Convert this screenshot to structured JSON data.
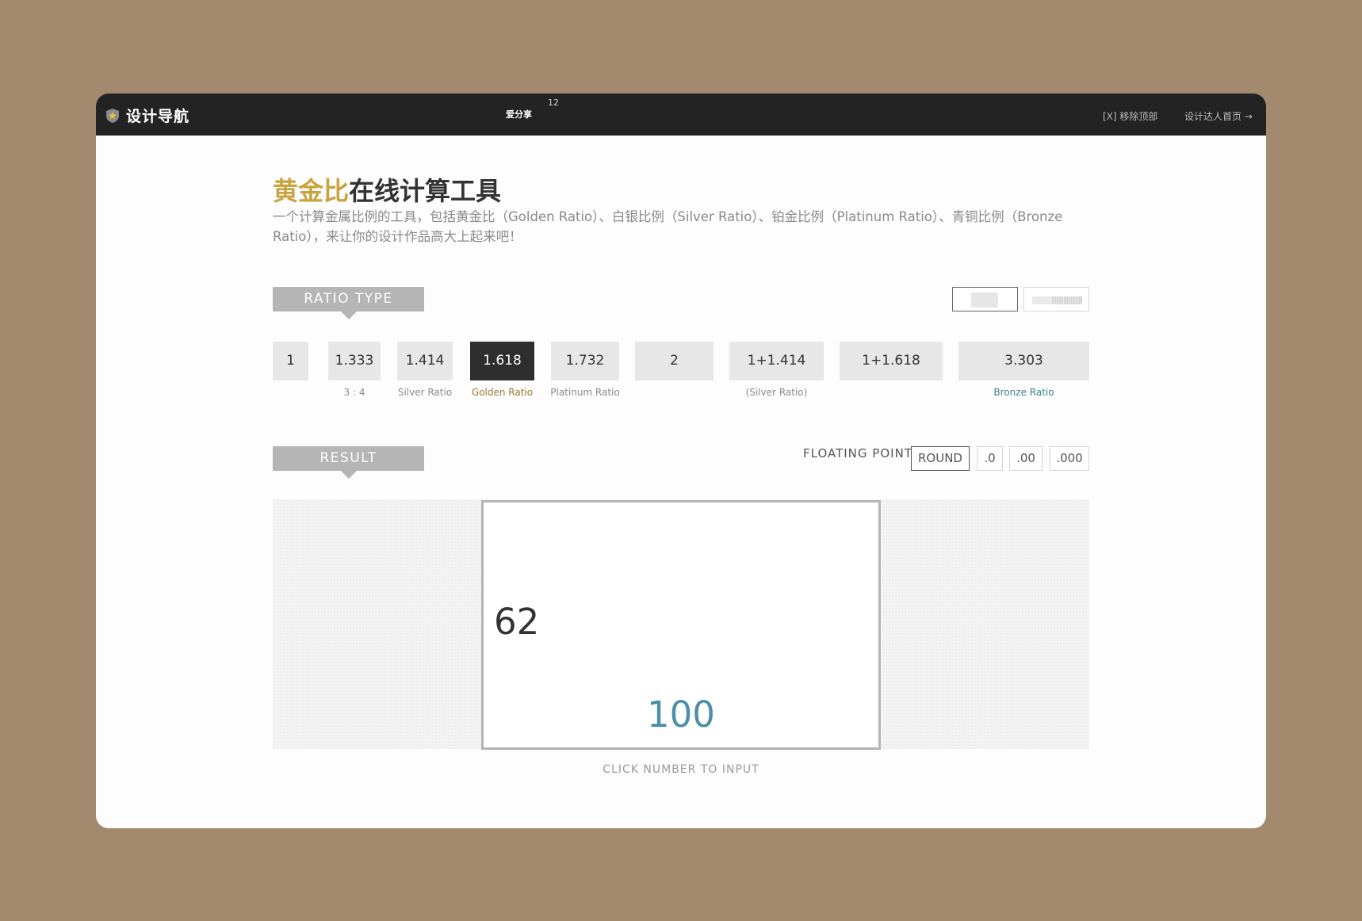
{
  "topbar": {
    "brand": "设计导航",
    "share_label": "爱分享",
    "share_count": "12",
    "remove_top": "[X] 移除顶部",
    "home_link": "设计达人首页 →"
  },
  "header": {
    "title_highlight": "黄金比",
    "title_rest": "在线计算工具",
    "description": "一个计算金属比例的工具，包括黄金比（Golden Ratio）、白银比例（Silver Ratio）、铂金比例（Platinum Ratio）、青铜比例（Bronze Ratio），来让你的设计作品高大上起来吧！"
  },
  "ratio_section": {
    "tag": "RATIO TYPE",
    "ratios": [
      {
        "value": "1",
        "label": ""
      },
      {
        "value": "1.333",
        "label": "3 : 4"
      },
      {
        "value": "1.414",
        "label": "Silver Ratio"
      },
      {
        "value": "1.618",
        "label": "Golden Ratio",
        "active": true
      },
      {
        "value": "1.732",
        "label": "Platinum Ratio"
      },
      {
        "value": "2",
        "label": ""
      },
      {
        "value": "1+1.414",
        "label": "(Silver Ratio)"
      },
      {
        "value": "1+1.618",
        "label": ""
      },
      {
        "value": "3.303",
        "label": "Bronze Ratio"
      }
    ]
  },
  "result_section": {
    "tag": "RESULT",
    "floating_point_label": "FLOATING POINT",
    "floating_options": [
      "ROUND",
      ".0",
      ".00",
      ".000"
    ],
    "floating_selected": "ROUND",
    "height_value": "62",
    "width_value": "100",
    "hint": "CLICK NUMBER TO INPUT"
  },
  "colors": {
    "gold": "#c9a43e",
    "width_blue": "#4c8fa6",
    "active_dark": "#2e2e2e",
    "background": "#a3896d"
  }
}
